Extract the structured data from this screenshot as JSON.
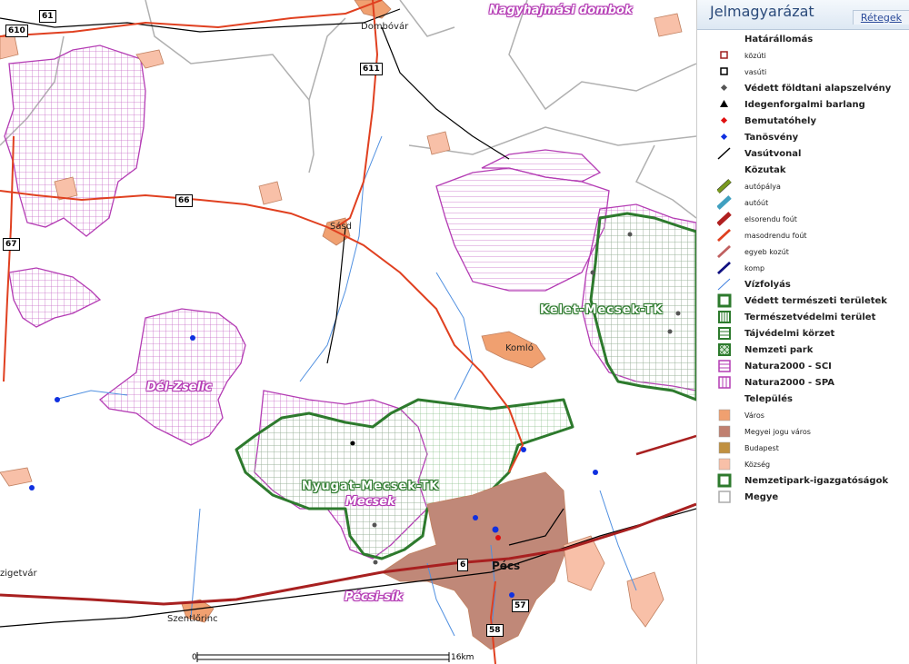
{
  "map": {
    "towns": [
      "Dombóvár",
      "Sásd",
      "Komló",
      "Pécs",
      "Szentlőrinc",
      "zigetvár"
    ],
    "regions": [
      "Nagyhajmási dombok",
      "Dél-Zselic",
      "Mecsek",
      "Pécsi-sík"
    ],
    "parks": [
      "Kelet-Mecsek-TK",
      "Nyugat-Mecsek-TK"
    ],
    "road_numbers": [
      "61",
      "610",
      "611",
      "66",
      "67",
      "6",
      "57",
      "58"
    ],
    "scale": {
      "start": "0",
      "end": "16km"
    }
  },
  "legend": {
    "title": "Jelmagyarázat",
    "layers_tab": "Rétegek",
    "items": [
      {
        "label": "Határállomás",
        "kind": "head"
      },
      {
        "label": "közúti",
        "kind": "small",
        "icon": "square-red-icon",
        "color": "#a02020"
      },
      {
        "label": "vasúti",
        "kind": "small",
        "icon": "square-black-icon",
        "color": "#000000"
      },
      {
        "label": "Védett földtani alapszelvény",
        "kind": "item",
        "icon": "diamond-gray-icon",
        "color": "#555555"
      },
      {
        "label": "Idegenforgalmi barlang",
        "kind": "item",
        "icon": "triangle-icon",
        "color": "#000000"
      },
      {
        "label": "Bemutatóhely",
        "kind": "item",
        "icon": "diamond-red-icon",
        "color": "#e01010"
      },
      {
        "label": "Tanösvény",
        "kind": "item",
        "icon": "diamond-blue-icon",
        "color": "#1030e0"
      },
      {
        "label": "Vasútvonal",
        "kind": "item",
        "icon": "railway-icon",
        "color": "#000000"
      },
      {
        "label": "Közutak",
        "kind": "head"
      },
      {
        "label": "autópálya",
        "kind": "small",
        "icon": "motorway-icon",
        "color": "#7a9a20"
      },
      {
        "label": "autóút",
        "kind": "small",
        "icon": "expressway-icon",
        "color": "#40a0c0"
      },
      {
        "label": "elsorendu foút",
        "kind": "small",
        "icon": "primary-road-icon",
        "color": "#b02020"
      },
      {
        "label": "masodrendu foút",
        "kind": "small",
        "icon": "secondary-road-icon",
        "color": "#e04020"
      },
      {
        "label": "egyeb kozút",
        "kind": "small",
        "icon": "other-road-icon",
        "color": "#c06060"
      },
      {
        "label": "komp",
        "kind": "small",
        "icon": "ferry-icon",
        "color": "#101080"
      },
      {
        "label": "Vízfolyás",
        "kind": "item",
        "icon": "stream-icon",
        "color": "#4080e0"
      },
      {
        "label": "Védett természeti területek",
        "kind": "item",
        "icon": "protected-area-icon",
        "color": "#2d7a2d"
      },
      {
        "label": "Természetvédelmi terület",
        "kind": "item",
        "icon": "nature-reserve-icon",
        "color": "#2d7a2d"
      },
      {
        "label": "Tájvédelmi körzet",
        "kind": "item",
        "icon": "landscape-area-icon",
        "color": "#2d7a2d"
      },
      {
        "label": "Nemzeti park",
        "kind": "item",
        "icon": "national-park-icon",
        "color": "#2d7a2d"
      },
      {
        "label": "Natura2000 - SCI",
        "kind": "item",
        "icon": "natura-sci-icon",
        "color": "#b43cb4"
      },
      {
        "label": "Natura2000 - SPA",
        "kind": "item",
        "icon": "natura-spa-icon",
        "color": "#b43cb4"
      },
      {
        "label": "Település",
        "kind": "head"
      },
      {
        "label": "Város",
        "kind": "small",
        "icon": "city-icon",
        "color": "#f0a070"
      },
      {
        "label": "Megyei jogu város",
        "kind": "small",
        "icon": "county-city-icon",
        "color": "#c08070"
      },
      {
        "label": "Budapest",
        "kind": "small",
        "icon": "budapest-icon",
        "color": "#c09040"
      },
      {
        "label": "Község",
        "kind": "small",
        "icon": "village-icon",
        "color": "#f8c0a8"
      },
      {
        "label": "Nemzetipark-igazgatóságok",
        "kind": "item",
        "icon": "park-directorate-icon",
        "color": "#2d7a2d"
      },
      {
        "label": "Megye",
        "kind": "item",
        "icon": "county-icon",
        "color": "#aaaaaa"
      }
    ]
  }
}
